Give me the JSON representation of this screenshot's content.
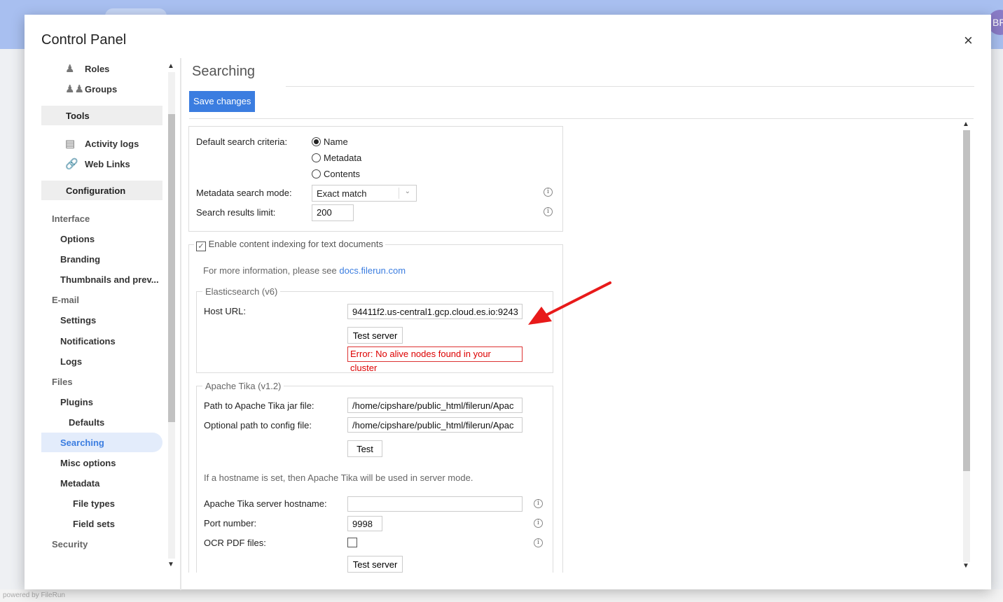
{
  "background": {
    "avatar_initials": "BR",
    "footer": "powered by FileRun"
  },
  "dialog": {
    "title": "Control Panel",
    "close_glyph": "×"
  },
  "sidebar": {
    "users_items": [
      {
        "label": "Roles",
        "icon": "role-icon"
      },
      {
        "label": "Groups",
        "icon": "groups-icon"
      }
    ],
    "tools_label": "Tools",
    "tools_items": [
      {
        "label": "Activity logs",
        "icon": "log-icon"
      },
      {
        "label": "Web Links",
        "icon": "link-icon"
      }
    ],
    "configuration_label": "Configuration",
    "interface_label": "Interface",
    "interface_items": [
      "Options",
      "Branding",
      "Thumbnails and prev..."
    ],
    "email_label": "E-mail",
    "email_items": [
      "Settings",
      "Notifications",
      "Logs"
    ],
    "files_label": "Files",
    "plugins_label": "Plugins",
    "plugins_sub": "Defaults",
    "searching_label": "Searching",
    "misc_label": "Misc options",
    "metadata_label": "Metadata",
    "metadata_items": [
      "File types",
      "Field sets"
    ],
    "security_label": "Security"
  },
  "main": {
    "title": "Searching",
    "save_label": "Save changes",
    "search": {
      "criteria_label": "Default search criteria:",
      "criteria_options": [
        "Name",
        "Metadata",
        "Contents"
      ],
      "criteria_selected": "Name",
      "mode_label": "Metadata search mode:",
      "mode_value": "Exact match",
      "limit_label": "Search results limit:",
      "limit_value": "200"
    },
    "indexing": {
      "enable_label": "Enable content indexing for text documents",
      "enabled": true,
      "info_text": "For more information, please see ",
      "info_link": "docs.filerun.com",
      "elastic": {
        "legend": "Elasticsearch (v6)",
        "host_label": "Host URL:",
        "host_value": "94411f2.us-central1.gcp.cloud.es.io:9243",
        "test_label": "Test server",
        "error": "Error: No alive nodes found in your cluster"
      },
      "tika": {
        "legend": "Apache Tika (v1.2)",
        "jar_label": "Path to Apache Tika jar file:",
        "jar_value": "/home/cipshare/public_html/filerun/Apac",
        "config_label": "Optional path to config file:",
        "config_value": "/home/cipshare/public_html/filerun/Apac",
        "test_label": "Test",
        "server_note": "If a hostname is set, then Apache Tika will be used in server mode.",
        "hostname_label": "Apache Tika server hostname:",
        "hostname_value": "",
        "port_label": "Port number:",
        "port_value": "9998",
        "ocr_label": "OCR PDF files:",
        "ocr_enabled": false,
        "test_server_label": "Test server"
      }
    }
  }
}
